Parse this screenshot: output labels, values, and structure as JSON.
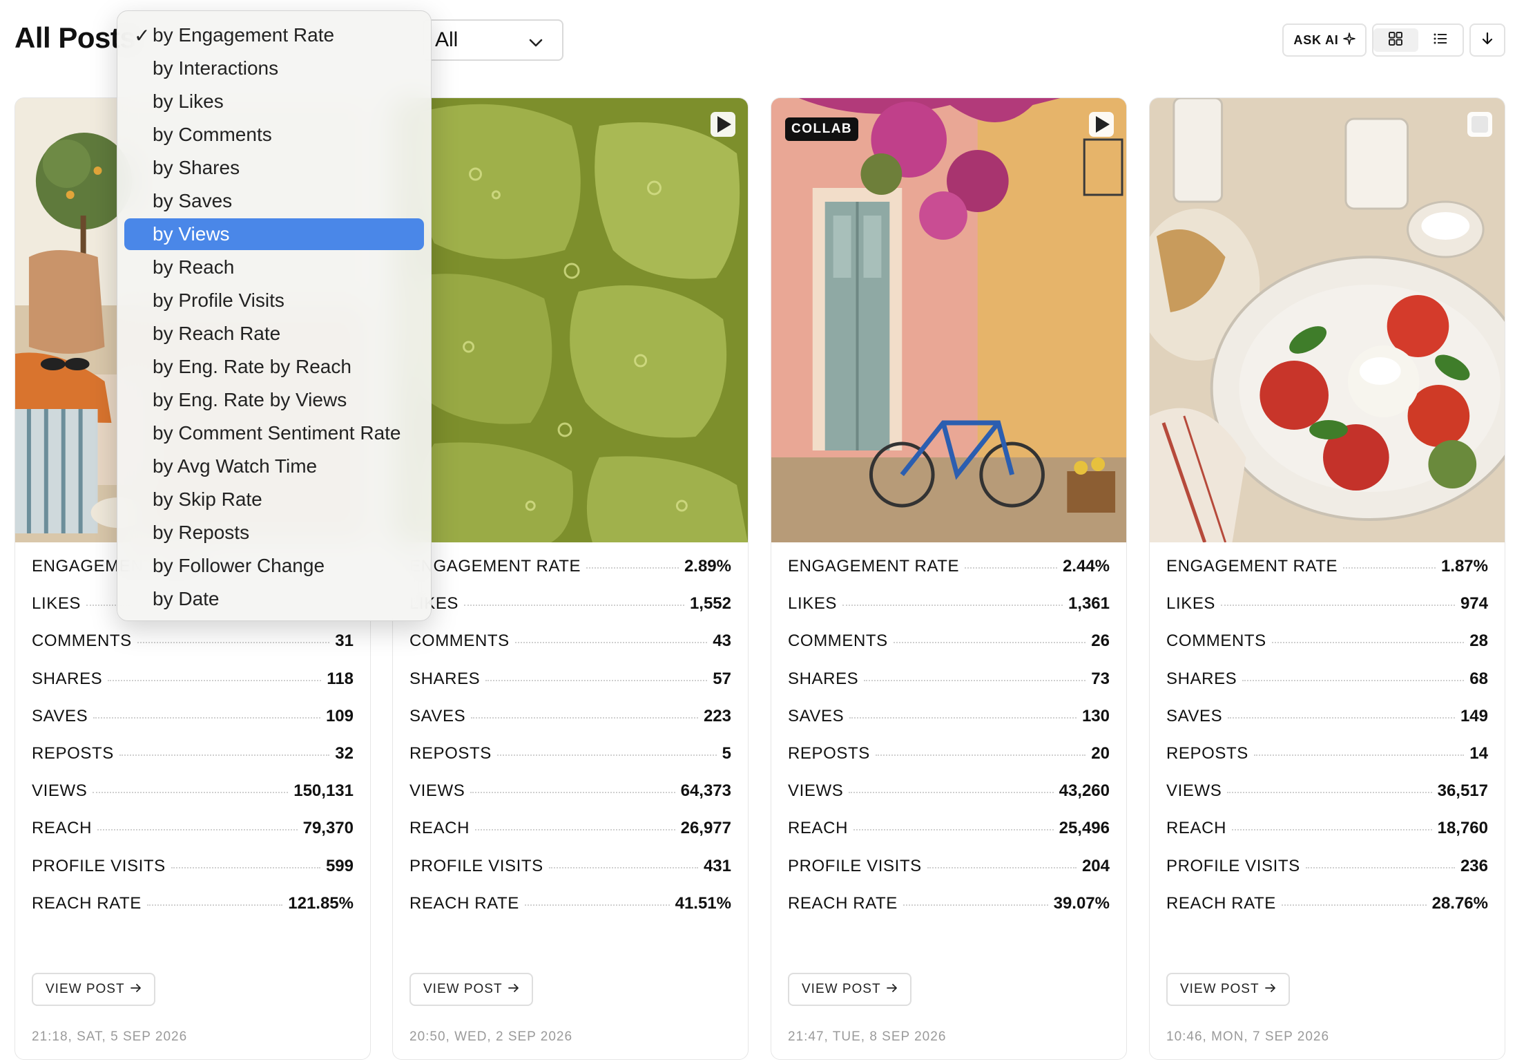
{
  "header": {
    "title": "All Posts",
    "filter_value": "All",
    "ask_ai_label": "ASK AI"
  },
  "sort_menu": {
    "checked": "by Engagement Rate",
    "highlighted": "by Views",
    "items": [
      "by Engagement Rate",
      "by Interactions",
      "by Likes",
      "by Comments",
      "by Shares",
      "by Saves",
      "by Views",
      "by Reach",
      "by Profile Visits",
      "by Reach Rate",
      "by Eng. Rate by Reach",
      "by Eng. Rate by Views",
      "by Comment Sentiment Rate",
      "by Avg Watch Time",
      "by Skip Rate",
      "by Reposts",
      "by Follower Change",
      "by Date"
    ]
  },
  "stat_labels": [
    "ENGAGEMENT RATE",
    "LIKES",
    "COMMENTS",
    "SHARES",
    "SAVES",
    "REPOSTS",
    "VIEWS",
    "REACH",
    "PROFILE VISITS",
    "REACH RATE"
  ],
  "view_post_label": "VIEW POST",
  "posts": [
    {
      "badge": "",
      "media_icon": "",
      "stats": [
        "",
        "",
        "31",
        "118",
        "109",
        "32",
        "150,131",
        "79,370",
        "599",
        "121.85%"
      ],
      "date": "21:18, SAT, 5 SEP 2026"
    },
    {
      "badge": "",
      "media_icon": "play-icon",
      "stats": [
        "2.89%",
        "1,552",
        "43",
        "57",
        "223",
        "5",
        "64,373",
        "26,977",
        "431",
        "41.51%"
      ],
      "date": "20:50, WED, 2 SEP 2026"
    },
    {
      "badge": "COLLAB",
      "media_icon": "play-icon",
      "stats": [
        "2.44%",
        "1,361",
        "26",
        "73",
        "130",
        "20",
        "43,260",
        "25,496",
        "204",
        "39.07%"
      ],
      "date": "21:47, TUE, 8 SEP 2026"
    },
    {
      "badge": "",
      "media_icon": "carousel-icon",
      "stats": [
        "1.87%",
        "974",
        "28",
        "68",
        "149",
        "14",
        "36,517",
        "18,760",
        "236",
        "28.76%"
      ],
      "date": "10:46, MON, 7 SEP 2026"
    }
  ]
}
